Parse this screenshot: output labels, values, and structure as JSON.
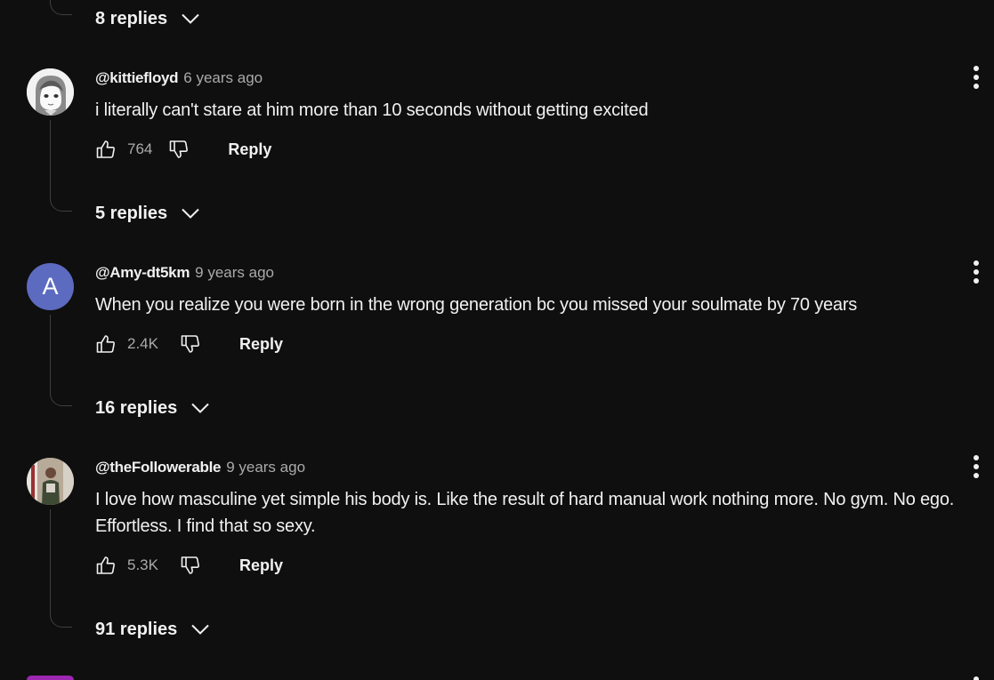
{
  "colors": {
    "background": "#0f0f0f",
    "text_primary": "#f1f1f1",
    "text_secondary": "#aaaaaa",
    "thread_line": "#3f3f3f",
    "letter_avatar": "#5c6bc0"
  },
  "top_replies_toggle": {
    "label": "8 replies",
    "icon": "chevron-down-icon"
  },
  "comments": [
    {
      "author": "@kittiefloyd",
      "age": "6 years ago",
      "text": "i literally can't stare at him more than 10 seconds without getting excited",
      "likes": "764",
      "reply_label": "Reply",
      "replies_label": "5 replies",
      "avatar": "anime-girl-drawing"
    },
    {
      "author": "@Amy-dt5km",
      "age": "9 years ago",
      "text": "When you realize you were born in the wrong generation bc you missed your soulmate by 70 years",
      "likes": "2.4K",
      "reply_label": "Reply",
      "replies_label": "16 replies",
      "avatar_letter": "A"
    },
    {
      "author": "@theFollowerable",
      "age": "9 years ago",
      "text": "I love how masculine yet simple his body is. Like the result of hard manual work nothing more. No gym. No ego. Effortless. I find that so sexy.",
      "likes": "5.3K",
      "reply_label": "Reply",
      "replies_label": "91 replies",
      "avatar": "person-photo"
    }
  ]
}
